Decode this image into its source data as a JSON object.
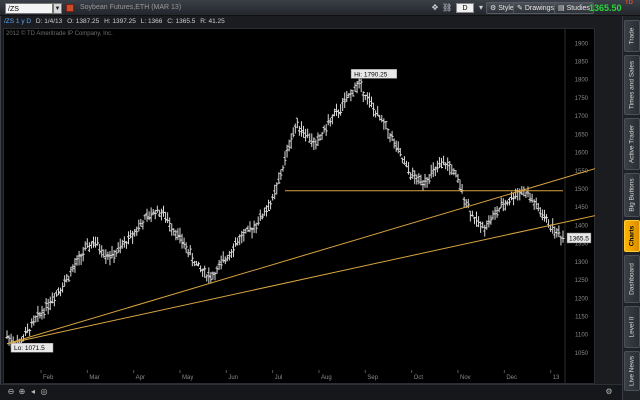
{
  "toolbar": {
    "symbol": "/ZS",
    "description": "Soybean Futures,ETH (MAR 13)",
    "timeframe": "D",
    "style_label": "Style",
    "drawings_label": "Drawings",
    "studies_label": "Studies",
    "last_price": "1365.50",
    "corner_label": "TD"
  },
  "info": {
    "symbol_period": "/ZS 1 y D",
    "date": "D: 1/4/13",
    "open": "O: 1387.25",
    "high": "H: 1397.25",
    "low": "L: 1366",
    "close": "C: 1365.5",
    "range": "R: 41.25"
  },
  "copyright": "2012 © TD Ameritrade IP Company, Inc.",
  "sidebar_tabs": [
    "Trade",
    "Times and Sales",
    "Active Trader",
    "Big Buttons",
    "Charts",
    "Dashboard",
    "Level II",
    "Live News"
  ],
  "active_tab": "Charts",
  "colors": {
    "accent": "#ffb400",
    "price_up": "#28d53a",
    "bars": "#d9d9d9",
    "trendline": "#d9a441"
  },
  "chart_data": {
    "type": "ohlc-bar",
    "xlabels": [
      "Feb",
      "Mar",
      "Apr",
      "May",
      "Jun",
      "Jul",
      "Aug",
      "Sep",
      "Oct",
      "Nov",
      "Dec",
      "13"
    ],
    "yticks": [
      1050,
      1100,
      1150,
      1200,
      1250,
      1300,
      1350,
      1400,
      1450,
      1500,
      1550,
      1600,
      1650,
      1700,
      1750,
      1800,
      1850,
      1900
    ],
    "ylim": [
      1025,
      1920
    ],
    "high_label": "Hi: 1790.25",
    "low_label": "Lo: 1071.5",
    "price_label": "1365.5",
    "trend": [
      1096,
      1082,
      1075,
      1100,
      1125,
      1148,
      1170,
      1192,
      1215,
      1236,
      1262,
      1288,
      1316,
      1338,
      1355,
      1340,
      1322,
      1315,
      1330,
      1350,
      1368,
      1390,
      1410,
      1425,
      1440,
      1436,
      1415,
      1390,
      1365,
      1340,
      1310,
      1285,
      1270,
      1260,
      1275,
      1300,
      1325,
      1350,
      1370,
      1380,
      1398,
      1420,
      1445,
      1470,
      1520,
      1580,
      1640,
      1680,
      1660,
      1640,
      1620,
      1650,
      1680,
      1700,
      1720,
      1745,
      1770,
      1790,
      1760,
      1730,
      1700,
      1680,
      1650,
      1615,
      1580,
      1550,
      1530,
      1520,
      1530,
      1545,
      1560,
      1570,
      1555,
      1520,
      1480,
      1440,
      1410,
      1395,
      1410,
      1430,
      1450,
      1465,
      1480,
      1495,
      1490,
      1470,
      1445,
      1420,
      1400,
      1380,
      1366
    ],
    "horizontal_line": 1495,
    "trendline_1": [
      [
        0,
        1075
      ],
      [
        96,
        1560
      ]
    ],
    "trendline_2": [
      [
        0,
        1075
      ],
      [
        96,
        1430
      ]
    ]
  }
}
